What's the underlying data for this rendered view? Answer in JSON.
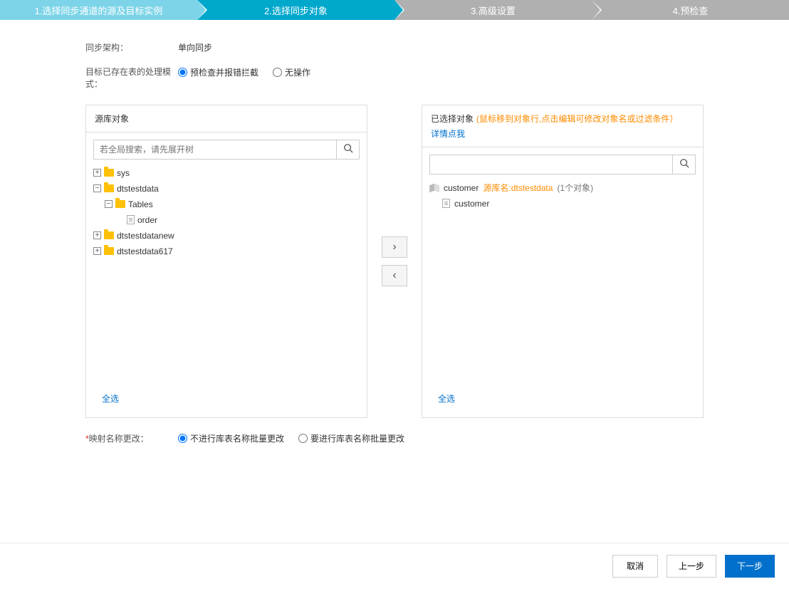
{
  "steps": {
    "s1": "1.选择同步通道的源及目标实例",
    "s2": "2.选择同步对象",
    "s3": "3.高级设置",
    "s4": "4.预检查"
  },
  "arch": {
    "label": "同步架构：",
    "value": "单向同步"
  },
  "existing": {
    "label": "目标已存在表的处理模式：",
    "opt1": "预检查并报错拦截",
    "opt2": "无操作"
  },
  "src_panel": {
    "title": "源库对象",
    "search_placeholder": "若全局搜索，请先展开树",
    "select_all": "全选"
  },
  "tree": {
    "n_sys": "sys",
    "n_dtstestdata": "dtstestdata",
    "n_tables": "Tables",
    "n_order": "order",
    "n_dtstestdatanew": "dtstestdatanew",
    "n_dtstestdata617": "dtstestdata617"
  },
  "sel_panel": {
    "title": "已选择对象",
    "hint": "(鼠标移到对象行,点击编辑可修改对象名或过滤条件）",
    "hint_link": "详情点我",
    "select_all": "全选"
  },
  "selected": {
    "item_name": "customer",
    "item_src": "源库名:dtstestdata",
    "item_count": "(1个对象)",
    "child_name": "customer"
  },
  "mapping": {
    "label": "映射名称更改：",
    "opt1": "不进行库表名称批量更改",
    "opt2": "要进行库表名称批量更改"
  },
  "buttons": {
    "cancel": "取消",
    "prev": "上一步",
    "next": "下一步"
  }
}
